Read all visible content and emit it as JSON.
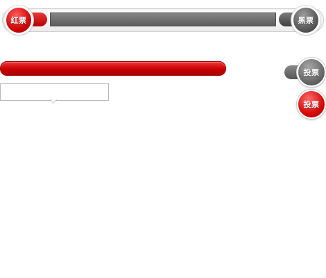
{
  "vote_bar": {
    "red_label": "红票",
    "black_label": "黑票"
  },
  "vote_buttons": {
    "gray_label": "投票",
    "red_label": "投票"
  },
  "colors": {
    "red": "#cf0707",
    "gray": "#5e5e5e"
  },
  "tooltip": {
    "text": ""
  }
}
